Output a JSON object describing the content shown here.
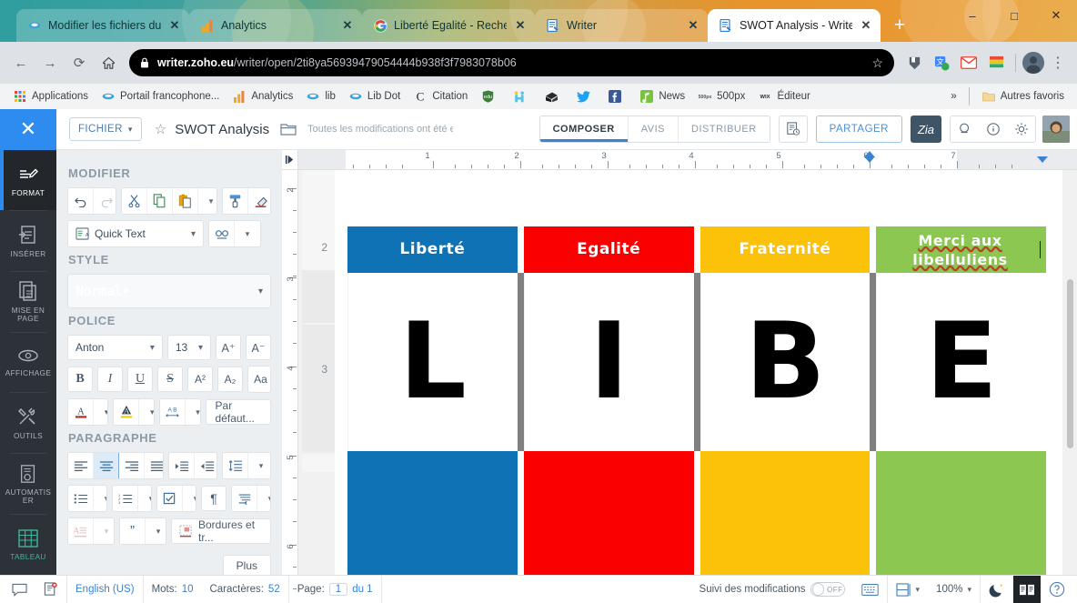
{
  "browser": {
    "tabs": [
      {
        "title": "Modifier les fichiers du",
        "icon": "zoho-icon",
        "active": false
      },
      {
        "title": "Analytics",
        "icon": "analytics-icon",
        "active": false
      },
      {
        "title": "Liberté Egalité - Recher",
        "icon": "google-icon",
        "active": false
      },
      {
        "title": "Writer",
        "icon": "writer-icon",
        "active": false
      },
      {
        "title": "SWOT Analysis - Writer",
        "icon": "writer-icon",
        "active": true
      }
    ],
    "new_tab_label": "+",
    "window_controls": {
      "minimize": "–",
      "maximize": "□",
      "close": "✕"
    },
    "nav": {
      "back": "←",
      "forward": "→",
      "reload": "⟳",
      "home": "⌂"
    },
    "omnibox": {
      "lock_icon": "lock-icon",
      "url_domain": "writer.zoho.eu",
      "url_path": "/writer/open/2ti8ya56939479054444b938f3f7983078b06",
      "star_icon": "bookmark-star-icon"
    },
    "bookmarks": [
      {
        "label": "Applications",
        "icon": "apps-grid-icon"
      },
      {
        "label": "Portail francophone...",
        "icon": "zoho-icon"
      },
      {
        "label": "Analytics",
        "icon": "analytics-icon"
      },
      {
        "label": "lib",
        "icon": "zoho-icon"
      },
      {
        "label": "Lib Dot",
        "icon": "zoho-icon"
      },
      {
        "label": "Citation",
        "icon": "citation-c-icon"
      },
      {
        "label": "",
        "icon": "green-shield-icon"
      },
      {
        "label": "",
        "icon": "hootsuite-icon"
      },
      {
        "label": "",
        "icon": "pocket-icon"
      },
      {
        "label": "",
        "icon": "twitter-icon"
      },
      {
        "label": "",
        "icon": "facebook-icon"
      },
      {
        "label": "News",
        "icon": "google-news-icon"
      },
      {
        "label": "500px",
        "icon": "500px-icon"
      },
      {
        "label": "Éditeur",
        "icon": "wix-icon"
      }
    ],
    "overflow_label": "»",
    "other_bookmarks": {
      "label": "Autres favoris",
      "icon": "folder-icon"
    }
  },
  "app": {
    "close_label": "✕",
    "file_menu": "FICHIER",
    "star_icon": "favorite-star-icon",
    "doc_title": "SWOT Analysis",
    "folder_icon": "folder-icon",
    "save_status": "Toutes les modifications ont été enregi",
    "tabs": [
      {
        "label": "COMPOSER",
        "active": true
      },
      {
        "label": "AVIS",
        "active": false
      },
      {
        "label": "DISTRIBUER",
        "active": false
      }
    ],
    "sign_icon": "signature-request-icon",
    "share_label": "PARTAGER",
    "zia_label": "Zia",
    "right_icons": [
      "search-icon",
      "info-icon",
      "gear-icon"
    ],
    "avatar": "user-avatar"
  },
  "rail": [
    {
      "label": "FORMAT",
      "icon": "format-brush-icon",
      "active": true
    },
    {
      "label": "INSÉRER",
      "icon": "insert-doc-icon",
      "active": false
    },
    {
      "label": "MISE EN PAGE",
      "icon": "page-layout-icon",
      "active": false
    },
    {
      "label": "AFFICHAGE",
      "icon": "eye-icon",
      "active": false
    },
    {
      "label": "OUTILS",
      "icon": "tools-icon",
      "active": false
    },
    {
      "label": "AUTOMATIS ER",
      "icon": "automation-icon",
      "active": false
    },
    {
      "label": "TABLEAU",
      "icon": "table-icon",
      "active": false
    }
  ],
  "panel": {
    "sections": {
      "modifier": "MODIFIER",
      "style": "STYLE",
      "police": "POLICE",
      "paragraphe": "PARAGRAPHE"
    },
    "modifier_buttons": [
      {
        "name": "undo-button",
        "glyph": "↶"
      },
      {
        "name": "redo-button",
        "glyph": "↷"
      },
      {
        "name": "cut-button",
        "glyph": "✂"
      },
      {
        "name": "copy-button",
        "glyph": "⧉"
      },
      {
        "name": "paste-button",
        "glyph": "Ὄb"
      },
      {
        "name": "paste-dropdown",
        "glyph": "⌄"
      },
      {
        "name": "format-painter-button",
        "glyph": "὘c"
      },
      {
        "name": "clear-formatting-button",
        "glyph": "⌫"
      }
    ],
    "quick_text_label": "Quick Text",
    "find_replace_icon": "find-replace-icon",
    "style_value": "Normal•",
    "font_family": "Anton",
    "font_size": "13",
    "increase_font": "A⁺",
    "decrease_font": "A⁻",
    "bold": "B",
    "italic": "I",
    "underline": "U",
    "strike": "S",
    "superscript": "A²",
    "subscript": "A₂",
    "change_case": "Aa",
    "text_color": "A",
    "highlight_color": "A",
    "char_spacing": "AB",
    "default_label": "Par défaut...",
    "borders_label": "Bordures et tr...",
    "more_label": "Plus"
  },
  "document": {
    "horizontal_ruler_numbers": [
      "1",
      "2",
      "3",
      "4",
      "5",
      "6",
      "7"
    ],
    "vertical_ruler_numbers": [
      "2",
      "3",
      "4",
      "5",
      "6"
    ],
    "gutter_numbers": [
      "2",
      "3"
    ],
    "table": {
      "headers": [
        {
          "text": "Liberté",
          "bg": "#0f72b5",
          "fg": "#ffffff"
        },
        {
          "text": "Egalité",
          "bg": "#fa0000",
          "fg": "#ffffff"
        },
        {
          "text": "Fraternité",
          "bg": "#fcc20a",
          "fg": "#ffffff"
        },
        {
          "text": "Merci aux libelluliens",
          "bg": "#8bc751",
          "fg": "#ffffff",
          "misspelled": true
        }
      ],
      "body": [
        "L",
        "I",
        "B",
        "E"
      ],
      "footer_colors": [
        "#0f72b5",
        "#fa0000",
        "#fcc20a",
        "#8bc751"
      ]
    }
  },
  "status_bar": {
    "comment_icon": "comment-icon",
    "doc_issue_icon": "document-error-icon",
    "language": "English (US)",
    "words_label": "Mots:",
    "words_value": "10",
    "chars_label": "Caractères:",
    "chars_value": "52",
    "page_label": "Page:",
    "page_value": "1",
    "page_total": "du 1",
    "track_changes_label": "Suivi des modifications",
    "track_changes_state": "OFF",
    "keyboard_icon": "keyboard-icon",
    "layout_icon": "page-layout-icon",
    "zoom_value": "100%",
    "dark_mode_icon": "moon-icon",
    "reading_mode_icon": "reading-mode-icon",
    "help_icon": "help-icon"
  }
}
